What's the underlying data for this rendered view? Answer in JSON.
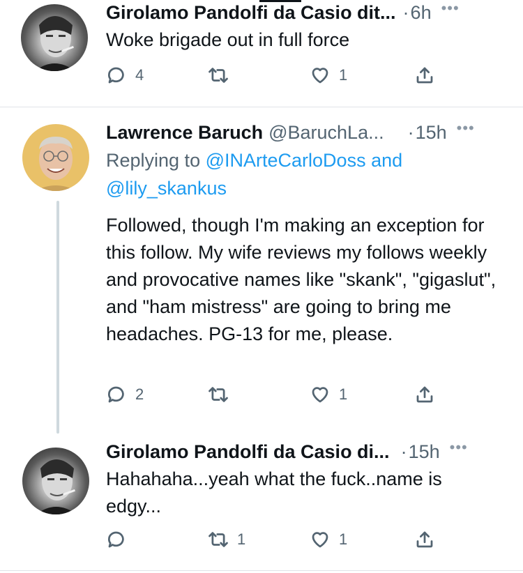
{
  "tweets": [
    {
      "name": "Girolamo Pandolfi da Casio dit...",
      "handle": "",
      "separator": "·",
      "time": "6h",
      "more": "•••",
      "replying_label": "",
      "mentions": [],
      "text": "Woke brigade out in full force",
      "replies": "4",
      "retweets": "",
      "likes": "1"
    },
    {
      "name": "Lawrence Baruch",
      "handle": "@BaruchLa...",
      "separator": "·",
      "time": "15h",
      "more": "•••",
      "replying_label": "Replying to",
      "mentions": [
        "@INArteCarloDoss",
        "and",
        "@lily_skankus"
      ],
      "text": "Followed, though I'm making an exception for this follow.  My wife reviews my follows weekly and provocative names like \"skank\", \"gigaslut\", and \"ham mistress\" are going to bring me headaches.  PG-13 for me, please.",
      "replies": "2",
      "retweets": "",
      "likes": "1"
    },
    {
      "name": "Girolamo Pandolfi da Casio di...",
      "handle": "",
      "separator": "·",
      "time": "15h",
      "more": "•••",
      "replying_label": "",
      "mentions": [],
      "text": "Hahahaha...yeah what the fuck..name is edgy...",
      "replies": "",
      "retweets": "1",
      "likes": "1"
    }
  ],
  "icons": {
    "reply": "reply-bubble-icon",
    "retweet": "retweet-arrows-icon",
    "like": "heart-icon",
    "share": "share-upload-icon"
  },
  "colors": {
    "text": "#0f1419",
    "secondary": "#536471",
    "link": "#1d9bf0",
    "divider": "#e1e4e8",
    "thread_line": "#cfd9de"
  }
}
